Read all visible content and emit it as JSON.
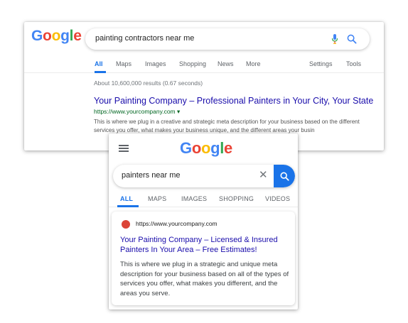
{
  "colors": {
    "google_blue": "#4285F4",
    "google_red": "#EA4335",
    "google_yellow": "#FBBC05",
    "google_green": "#34A853",
    "link_blue": "#1a0dab",
    "url_green": "#006621",
    "accent": "#1a73e8",
    "favicon": "#db4437"
  },
  "desktop": {
    "logo": "Google",
    "search": {
      "query": "painting contractors near me",
      "mic_icon": "mic-icon",
      "search_icon": "search-icon"
    },
    "tabs": [
      "All",
      "Maps",
      "Images",
      "Shopping",
      "News",
      "More"
    ],
    "active_tab": "All",
    "right_tabs": [
      "Settings",
      "Tools"
    ],
    "stats": "About 10,600,000 results (0.67 seconds)",
    "result": {
      "title": "Your Painting Company – Professional Painters in Your City, Your State",
      "url": "https://www.yourcompany.com ▾",
      "description": "This is where we plug in a creative and strategic meta description for your business based on the different services you offer, what makes your business unique, and the different areas your busin"
    }
  },
  "mobile": {
    "logo": "Google",
    "menu_icon": "hamburger-menu-icon",
    "search": {
      "query": "painters near me",
      "clear_label": "✕",
      "search_icon": "search-icon"
    },
    "tabs": [
      "ALL",
      "MAPS",
      "IMAGES",
      "SHOPPING",
      "VIDEOS"
    ],
    "active_tab": "ALL",
    "result": {
      "url": "https://www.yourcompany.com",
      "title": "Your Painting Company – Licensed & Insured Painters In Your Area – Free Estimates!",
      "description": "This is where we plug in a strategic and unique meta description for your business based on all of the types of services you offer, what makes you different, and the areas you serve."
    }
  }
}
